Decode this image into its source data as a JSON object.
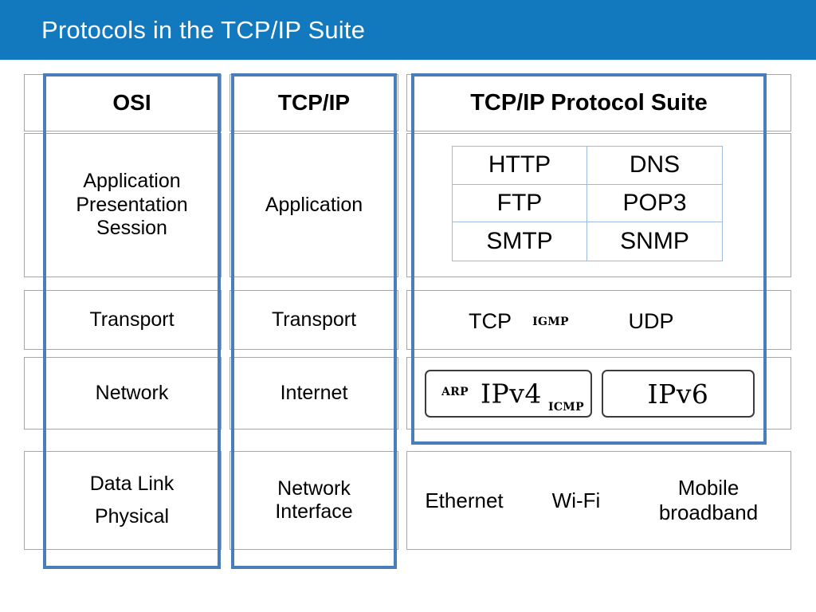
{
  "header": {
    "title": "Protocols in the TCP/IP Suite",
    "background_color": "#1279bf",
    "text_color": "#ffffff"
  },
  "colors": {
    "accent_blue": "#4a7ebb",
    "grid_gray": "#a6a6a6",
    "inner_table_border": "#9dbbdd",
    "box_border": "#3c3c3c"
  },
  "table": {
    "columns": [
      {
        "key": "osi",
        "header": "OSI"
      },
      {
        "key": "tcpip",
        "header": "TCP/IP"
      },
      {
        "key": "suite",
        "header": "TCP/IP Protocol Suite"
      }
    ],
    "rows": [
      {
        "osi": "Application\nPresentation\nSession",
        "osi_lines": [
          "Application",
          "Presentation",
          "Session"
        ],
        "tcpip": "Application"
      },
      {
        "osi": "Transport",
        "osi_lines": [
          "Transport"
        ],
        "tcpip": "Transport"
      },
      {
        "osi": "Network",
        "osi_lines": [
          "Network"
        ],
        "tcpip": "Internet"
      },
      {
        "osi": "Data Link\nPhysical",
        "osi_lines": [
          "Data Link",
          "Physical"
        ],
        "tcpip": "Network\nInterface",
        "tcpip_lines": [
          "Network",
          "Interface"
        ]
      }
    ]
  },
  "suite": {
    "application_protocols": {
      "grid": [
        [
          "HTTP",
          "DNS"
        ],
        [
          "FTP",
          "POP3"
        ],
        [
          "SMTP",
          "SNMP"
        ]
      ]
    },
    "transport_protocols": {
      "tcp": "TCP",
      "igmp": "IGMP",
      "udp": "UDP"
    },
    "internet_protocols": {
      "arp": "ARP",
      "ipv4": "IPv4",
      "icmp": "ICMP",
      "ipv6": "IPv6"
    },
    "link_protocols": {
      "ethernet": "Ethernet",
      "wifi": "Wi-Fi",
      "mobile_line1": "Mobile",
      "mobile_line2": "broadband"
    }
  }
}
